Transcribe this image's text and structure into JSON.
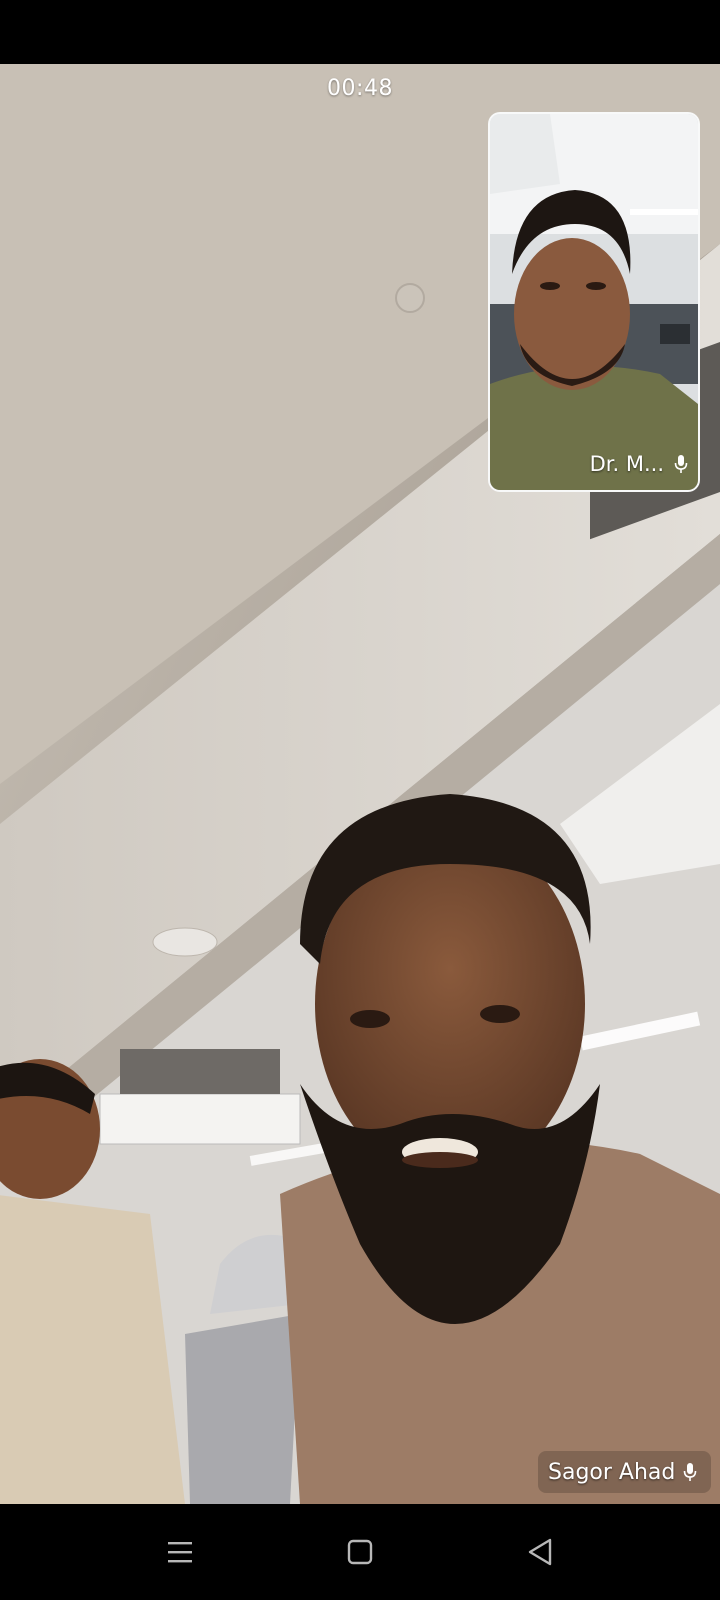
{
  "call": {
    "timer": "00:48",
    "self_name": "Dr. M...",
    "remote_name": "Sagor Ahad"
  },
  "icons": {
    "self_mic": "mic-icon",
    "remote_mic": "mic-icon",
    "nav_menu": "menu-icon",
    "nav_home": "home-square-icon",
    "nav_back": "back-triangle-icon"
  },
  "colors": {
    "overlay_text": "#ffffff",
    "background": "#000000"
  }
}
